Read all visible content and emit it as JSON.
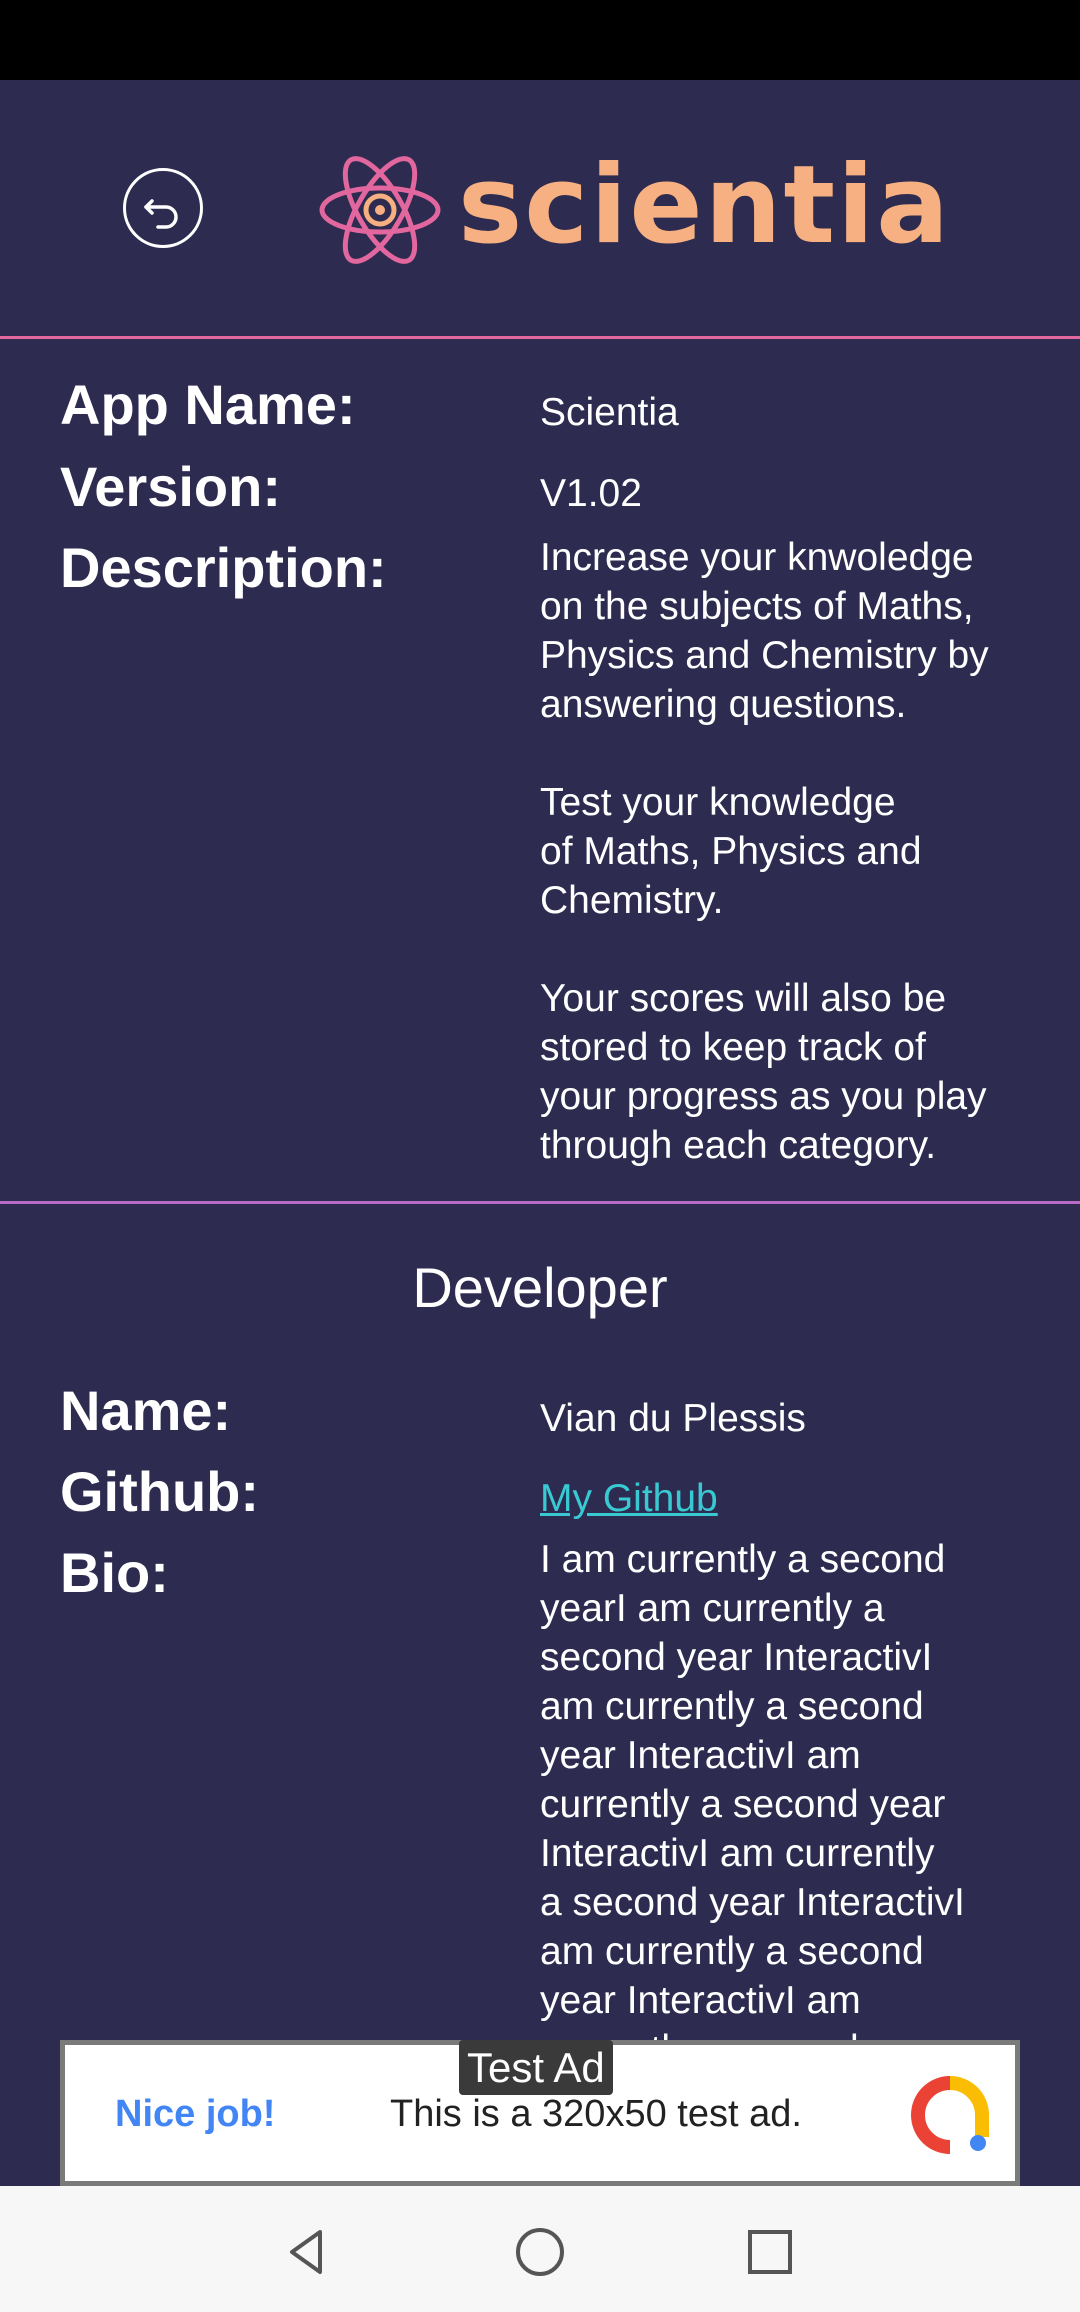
{
  "header": {
    "logo_text": "scientia",
    "back_icon": "back-arrow-circle-icon",
    "logo_icon": "atom-icon"
  },
  "app_info": {
    "app_name_label": "App Name:",
    "app_name_value": "Scientia",
    "version_label": "Version:",
    "version_value": "V1.02",
    "description_label": "Description:",
    "description_value": "Increase your knwoledge\non the subjects of Maths,\nPhysics and Chemistry by\nanswering questions.\n\nTest your knowledge\nof Maths, Physics and\nChemistry.\n\nYour scores will also be\nstored to keep track of\nyour progress as you play\nthrough each category."
  },
  "developer": {
    "section_title": "Developer",
    "name_label": "Name:",
    "name_value": "Vian du Plessis",
    "github_label": "Github:",
    "github_link_text": "My Github",
    "bio_label": "Bio:",
    "bio_value": "I am currently a second\nyearI am currently a\nsecond year InteractivI\nam currently a second\nyear InteractivI am\ncurrently a second year\nInteractivI am currently\na second year InteractivI\nam currently a second\nyear InteractivI am\ncurrently a second year"
  },
  "ad": {
    "tag": "Test Ad",
    "nice_job": "Nice job!",
    "text": "This is a 320x50 test ad.",
    "logo_icon": "ad-logo-icon"
  },
  "nav": {
    "back_icon": "nav-back-icon",
    "home_icon": "nav-home-icon",
    "recents_icon": "nav-recents-icon"
  },
  "colors": {
    "background": "#2d2b4f",
    "logo_text": "#f7b082",
    "logo_atom": "#e2679f",
    "link": "#39c9d3",
    "divider_top": "#e2679f",
    "divider_mid": "#b86bc5"
  }
}
